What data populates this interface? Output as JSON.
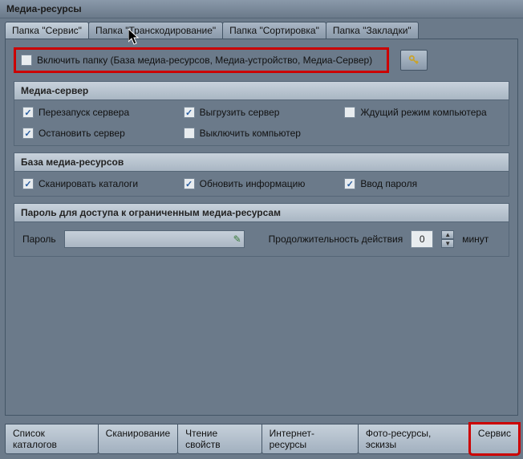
{
  "title": "Медиа-ресурсы",
  "topTabs": {
    "t0": "Папка \"Сервис\"",
    "t1": "Папка \"Транскодирование\"",
    "t2": "Папка \"Сортировка\"",
    "t3": "Папка \"Закладки\""
  },
  "enable": {
    "label": "Включить папку (База медиа-ресурсов, Медиа-устройство, Медиа-Сервер)",
    "keyIcon": "key-icon"
  },
  "group1": {
    "title": "Медиа-сервер",
    "c0": "Перезапуск сервера",
    "c1": "Выгрузить сервер",
    "c2": "Ждущий режим компьютера",
    "c3": "Остановить сервер",
    "c4": "Выключить компьютер"
  },
  "group2": {
    "title": "База медиа-ресурсов",
    "c0": "Сканировать каталоги",
    "c1": "Обновить информацию",
    "c2": "Ввод пароля"
  },
  "group3": {
    "title": "Пароль для доступа к ограниченным медиа-ресурсам",
    "pwdLabel": "Пароль",
    "durLabel": "Продолжительность действия",
    "durValue": "0",
    "unit": "минут"
  },
  "bottomTabs": {
    "b0": "Список каталогов",
    "b1": "Сканирование",
    "b2": "Чтение свойств",
    "b3": "Интернет-ресурсы",
    "b4": "Фото-ресурсы, эскизы",
    "b5": "Сервис"
  }
}
